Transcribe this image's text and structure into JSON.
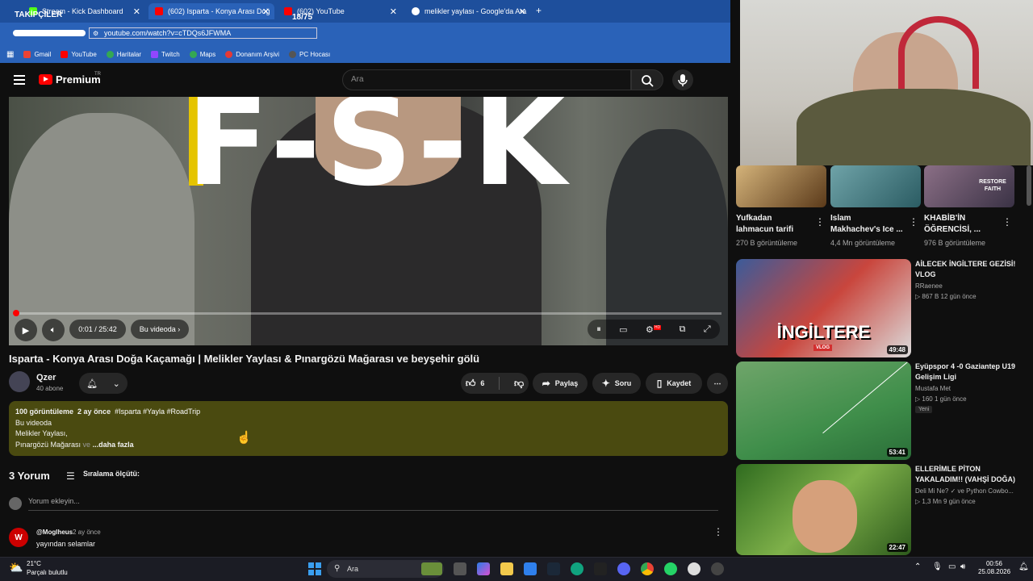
{
  "browser": {
    "tabs": [
      {
        "label": "Stream - Kick Dashboard"
      },
      {
        "label": "(602) Isparta - Konya Arası Doğ"
      },
      {
        "label": "(602) YouTube"
      },
      {
        "label": "melikler yaylası - Google'da Ara"
      }
    ],
    "overlay_followers": "TAKİPÇİLER",
    "overlay_count": "18/75",
    "url": "youtube.com/watch?v=cTDQs6JFWMA",
    "bookmarks": [
      "Gmail",
      "YouTube",
      "Haritalar",
      "Twitch",
      "Maps",
      "Donanım Arşivi",
      "PC Hocası"
    ]
  },
  "header": {
    "logo_text": "Premium",
    "logo_mark": "TR",
    "search_placeholder": "Ara"
  },
  "player": {
    "overlay_text": "F-S-K",
    "progress_fraction": 0.001,
    "time": "0:01 / 25:42",
    "chapter_label": "Bu videoda",
    "hd_badge": "HD"
  },
  "video": {
    "title": "Isparta - Konya Arası Doğa Kaçamağı | Melikler Yaylası & Pınargözü Mağarası ve beyşehir gölü",
    "channel": "Qzer",
    "subscribers": "40 abone",
    "likes": "6",
    "share_label": "Paylaş",
    "ask_label": "Soru",
    "save_label": "Kaydet"
  },
  "description": {
    "views": "100 görüntüleme",
    "date": "2 ay önce",
    "tags": "#Isparta #Yayla #RoadTrip",
    "line1": "Bu videoda",
    "line2": "Melikler Yaylası,",
    "line3_a": "Pınargözü Mağarası ",
    "line3_faded": "ve",
    "more": "...daha fazla"
  },
  "comments": {
    "count_label": "3 Yorum",
    "sort_label": "Sıralama ölçütü:",
    "add_placeholder": "Yorum ekleyin...",
    "items": [
      {
        "avatar_letter": "W",
        "user": "@Moglheus",
        "time": "2 ay önce",
        "text": "yayından selamlar"
      }
    ]
  },
  "shorts_row": [
    {
      "title_l1": "Yufkadan",
      "title_l2": "lahmacun tarifi",
      "views": "270 B görüntüleme"
    },
    {
      "title_l1": "Islam",
      "title_l2": "Makhachev's Ice ...",
      "views": "4,4 Mn görüntüleme"
    },
    {
      "title_l1": "KHABİB'İN",
      "title_l2": "ÖĞRENCİSİ, ...",
      "views": "976 B görüntüleme"
    }
  ],
  "shorts_thumb_text": "RESTORE FAITH",
  "recommendations": [
    {
      "title": "AİLECEK İNGİLTERE GEZİSİ! VLOG",
      "channel": "RRaenee",
      "meta": "▷ 867 B   12 gün önce",
      "duration": "49:48",
      "thumb_text": "İNGİLTERE",
      "thumb_badge": "VLOG"
    },
    {
      "title": "Eyüpspor 4 -0 Gaziantep U19 Gelişim Ligi",
      "channel": "Mustafa Met",
      "meta": "▷ 160   1 gün önce",
      "duration": "53:41",
      "badge": "Yeni"
    },
    {
      "title": "ELLERİMLE PİTON YAKALADIM!! (VAHŞİ DOĞA)",
      "channel": "Deli Mi Ne? ✓ ve Python Cowbo...",
      "meta": "▷ 1,3 Mn   9 gün önce",
      "duration": "22:47"
    }
  ],
  "taskbar": {
    "temp": "21°C",
    "condition": "Parçalı bulutlu",
    "search": "Ara",
    "time": "00:56",
    "date": "25.08.2026"
  }
}
